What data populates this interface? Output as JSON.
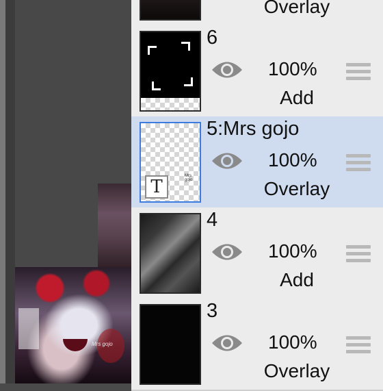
{
  "canvas": {
    "art_signature": "Mrs gojo"
  },
  "layers": [
    {
      "name": "",
      "opacity": "",
      "blend": "Overlay"
    },
    {
      "name": "6",
      "opacity": "100%",
      "blend": "Add"
    },
    {
      "name": "5:Mrs gojo",
      "opacity": "100%",
      "blend": "Overlay",
      "selected": true,
      "thumb_label": "T"
    },
    {
      "name": "4",
      "opacity": "100%",
      "blend": "Add"
    },
    {
      "name": "3",
      "opacity": "100%",
      "blend": "Overlay"
    }
  ],
  "colors": {
    "panel_bg": "#ececec",
    "selected_bg": "#cfdcf0",
    "selected_border": "#3d7be0",
    "icon_gray": "#8a8a8a"
  },
  "icons": {
    "visibility": "eye-icon",
    "reorder": "drag-handle-icon",
    "text_layer": "text-layer-icon"
  }
}
